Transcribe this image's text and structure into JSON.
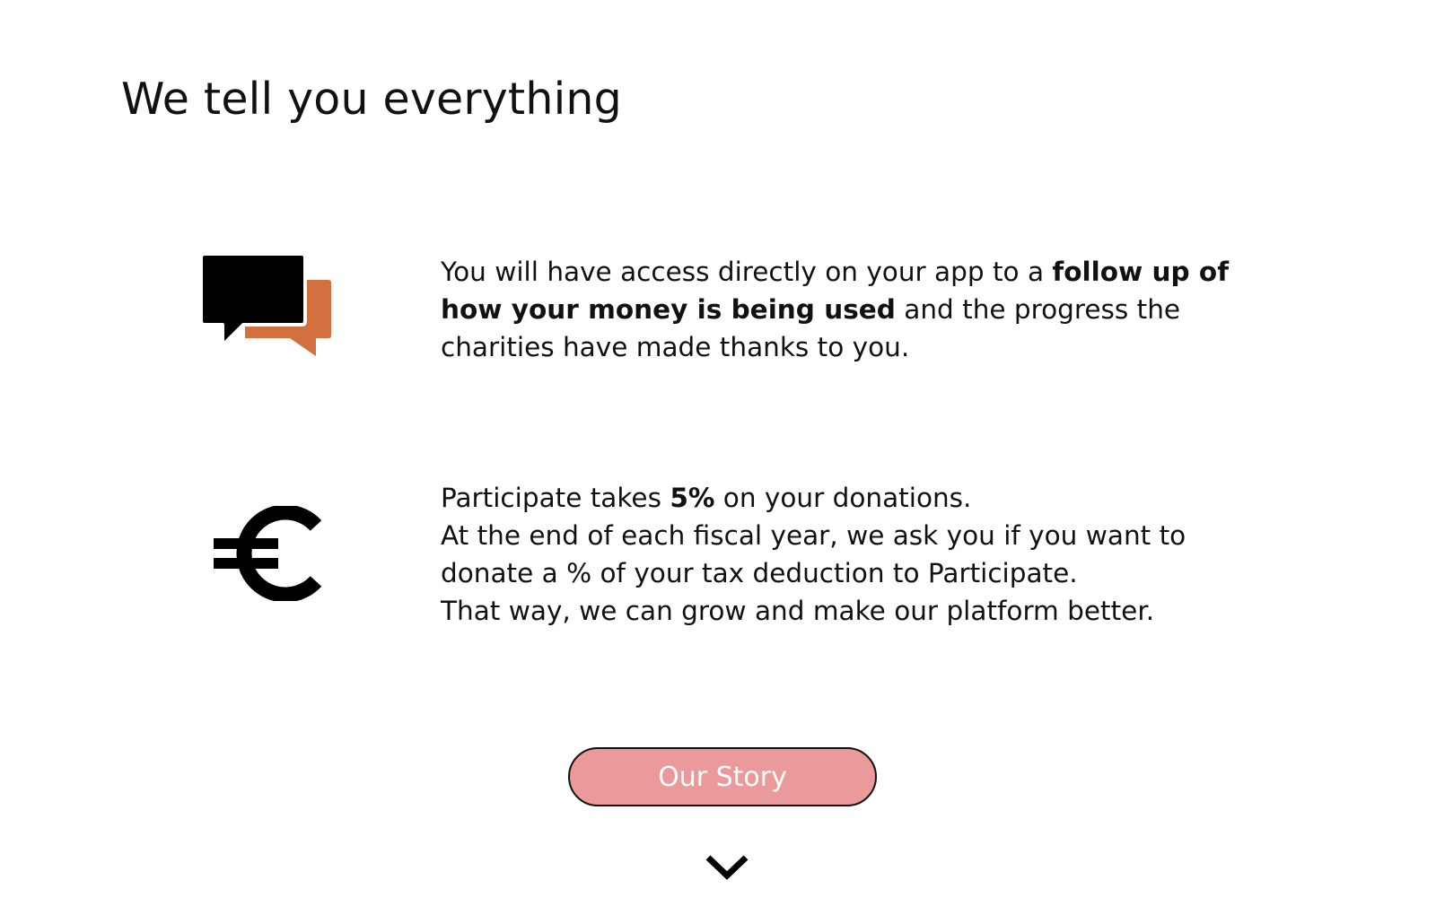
{
  "page": {
    "title": "We tell you everything"
  },
  "features": [
    {
      "icon": "chat-bubbles-icon",
      "text_before": "You will have access directly on your app to a ",
      "text_bold": "follow up of how your money is being used",
      "text_after": " and the progress the charities have made thanks to you."
    },
    {
      "icon": "euro-icon",
      "line1_before": "Participate takes ",
      "line1_bold": "5%",
      "line1_after": " on your donations.",
      "line2": "At the end of each fiscal year, we ask you if you want to donate a % of your tax deduction to Participate.",
      "line3": "That way, we can grow and make our platform better."
    }
  ],
  "cta": {
    "label": "Our Story"
  },
  "scroll": {
    "icon": "chevron-down-icon"
  },
  "colors": {
    "accent": "#d2713f",
    "button_fill": "#ea9a9a",
    "text": "#111111",
    "background": "#ffffff"
  }
}
